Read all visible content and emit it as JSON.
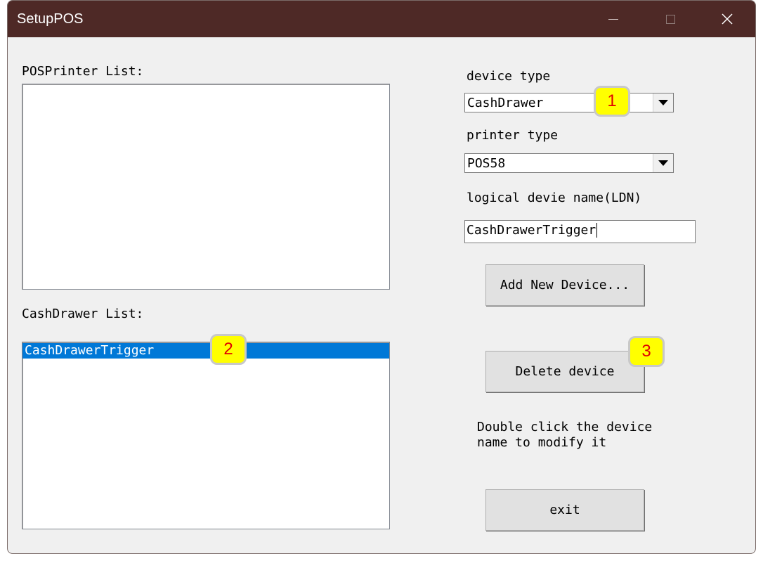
{
  "window": {
    "title": "SetupPOS",
    "titlebar_color": "#4e2926"
  },
  "titlebar_buttons": {
    "minimize_icon": "minimize-icon",
    "maximize_icon": "maximize-icon",
    "close_icon": "close-icon"
  },
  "printer_list": {
    "label": "POSPrinter List:",
    "items": []
  },
  "cashdrawer_list": {
    "label": "CashDrawer List:",
    "items": [
      "CashDrawerTrigger"
    ],
    "selected_index": 0
  },
  "device_type": {
    "label": "device type",
    "value": "CashDrawer"
  },
  "printer_type": {
    "label": "printer type",
    "value": "POS58"
  },
  "ldn": {
    "label": "logical devie name(LDN)",
    "value": "CashDrawerTrigger"
  },
  "buttons": {
    "add": "Add New Device...",
    "delete": "Delete device",
    "exit": "exit"
  },
  "hint": {
    "line1": "Double click the device",
    "line2": "name to modify it"
  },
  "annotations": [
    "1",
    "2",
    "3"
  ],
  "colors": {
    "selection": "#0078d7",
    "badge_fill": "#ffff00",
    "badge_text": "#e00000"
  }
}
